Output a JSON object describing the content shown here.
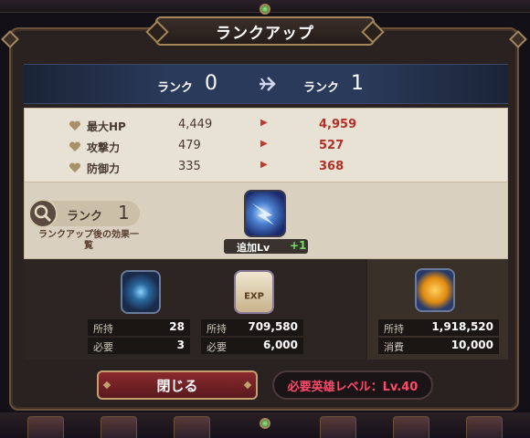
{
  "dialog": {
    "title": "ランクアップ",
    "close_label": "閉じる",
    "required_level": "必要英雄レベル：Lv.40"
  },
  "rank": {
    "label": "ランク",
    "from": "0",
    "to": "1"
  },
  "stats": [
    {
      "name": "最大HP",
      "from": "4,449",
      "to": "4,959"
    },
    {
      "name": "攻撃力",
      "from": "479",
      "to": "527"
    },
    {
      "name": "防御力",
      "from": "335",
      "to": "368"
    }
  ],
  "effect": {
    "rank_label": "ランク",
    "rank_value": "1",
    "note": "ランクアップ後の効果一覧",
    "skill_label": "追加Lv",
    "skill_plus": "+1"
  },
  "resources": [
    {
      "icon": "blue-gem-item-icon",
      "owned_label": "所持",
      "owned": "28",
      "need_label": "必要",
      "need": "3"
    },
    {
      "icon": "exp-scroll-icon",
      "owned_label": "所持",
      "owned": "709,580",
      "need_label": "必要",
      "need": "6,000"
    },
    {
      "icon": "gold-coin-icon",
      "owned_label": "所持",
      "owned": "1,918,520",
      "need_label": "消費",
      "need": "10,000"
    }
  ],
  "colors": {
    "stat_increase": "#b03028",
    "required_level": "#ff4a6a",
    "plus": "#6fe060"
  }
}
